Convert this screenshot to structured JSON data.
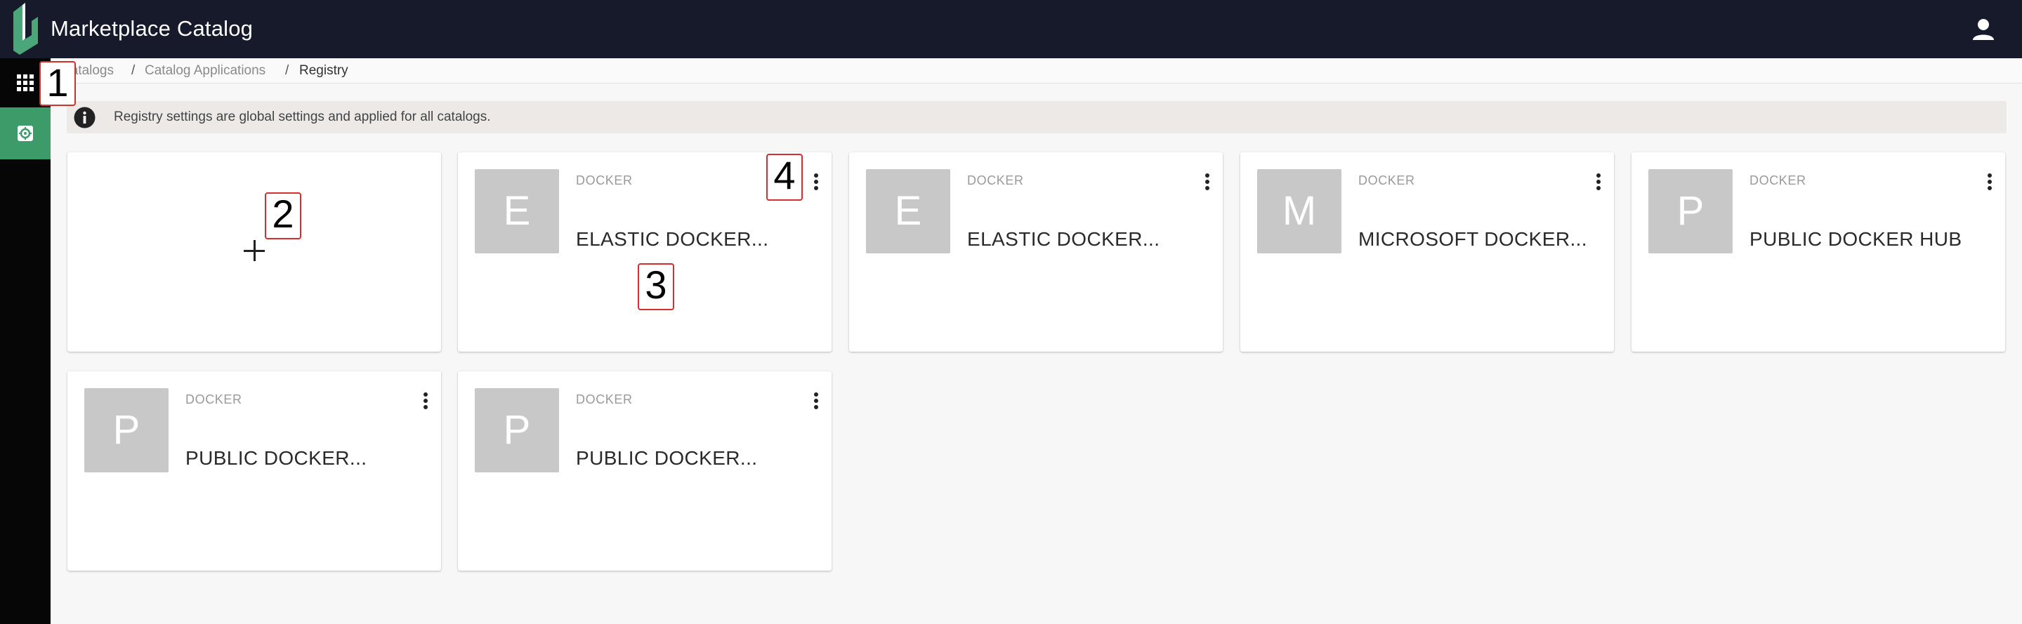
{
  "header": {
    "title": "Marketplace Catalog"
  },
  "breadcrumb": {
    "items": [
      "Catalogs",
      "Catalog Applications",
      "Registry"
    ],
    "separator": "/"
  },
  "info_banner": {
    "text": "Registry settings are global settings and applied for all catalogs."
  },
  "cards": [
    {
      "letter": "E",
      "type": "DOCKER",
      "name": "ELASTIC DOCKER..."
    },
    {
      "letter": "E",
      "type": "DOCKER",
      "name": "ELASTIC DOCKER..."
    },
    {
      "letter": "M",
      "type": "DOCKER",
      "name": "MICROSOFT DOCKER..."
    },
    {
      "letter": "P",
      "type": "DOCKER",
      "name": "PUBLIC DOCKER HUB"
    },
    {
      "letter": "P",
      "type": "DOCKER",
      "name": "PUBLIC DOCKER..."
    },
    {
      "letter": "P",
      "type": "DOCKER",
      "name": "PUBLIC DOCKER..."
    }
  ],
  "callouts": [
    "1",
    "2",
    "3",
    "4"
  ],
  "icons": {
    "logo": "product-logo-icon",
    "user": "user-icon",
    "apps": "apps-grid-icon",
    "settings": "settings-gear-icon",
    "info": "info-icon",
    "add": "plus-icon",
    "menu": "kebab-menu-icon"
  },
  "colors": {
    "header_bg": "#161a2b",
    "rail_bg": "#060606",
    "rail_active": "#3c9b69",
    "banner_bg": "#ece9e6",
    "avatar_bg": "#c8c8c8",
    "callout_border": "#d32f2f"
  }
}
